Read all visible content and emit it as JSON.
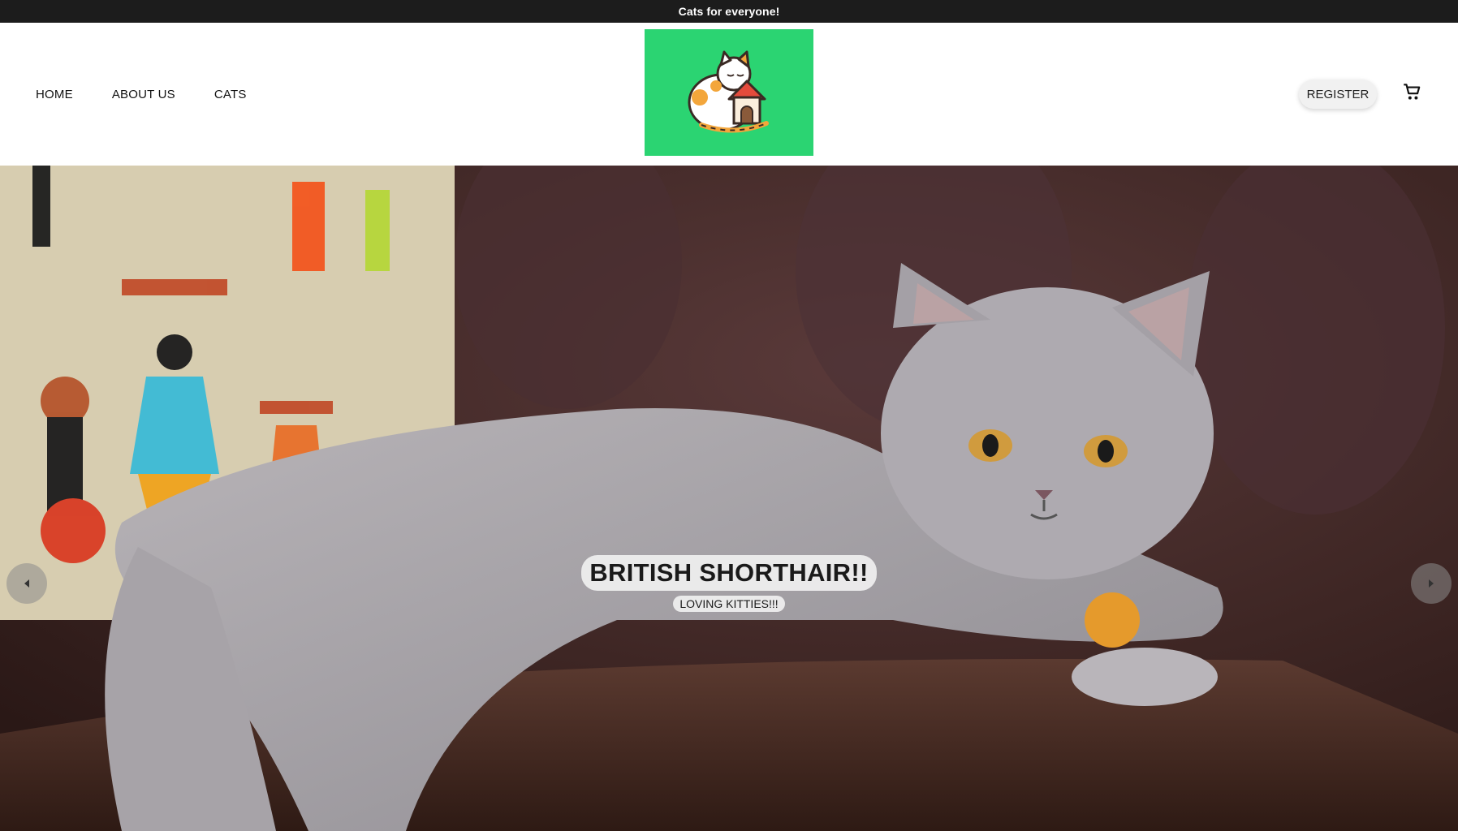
{
  "announcement": {
    "text": "Cats for everyone!"
  },
  "nav": {
    "items": [
      {
        "label": "HOME"
      },
      {
        "label": "ABOUT US"
      },
      {
        "label": "CATS"
      }
    ]
  },
  "header": {
    "logo_color": "#2bd472",
    "register_label": "REGISTER",
    "cart_icon": "shopping-cart-icon"
  },
  "hero": {
    "title": "BRITISH SHORTHAIR!!",
    "subtitle": "LOVING KITTIES!!!",
    "prev_icon": "chevron-left-icon",
    "next_icon": "chevron-right-icon"
  },
  "colors": {
    "announcement_bg": "#1c1c1c",
    "logo_bg": "#2bd472"
  }
}
